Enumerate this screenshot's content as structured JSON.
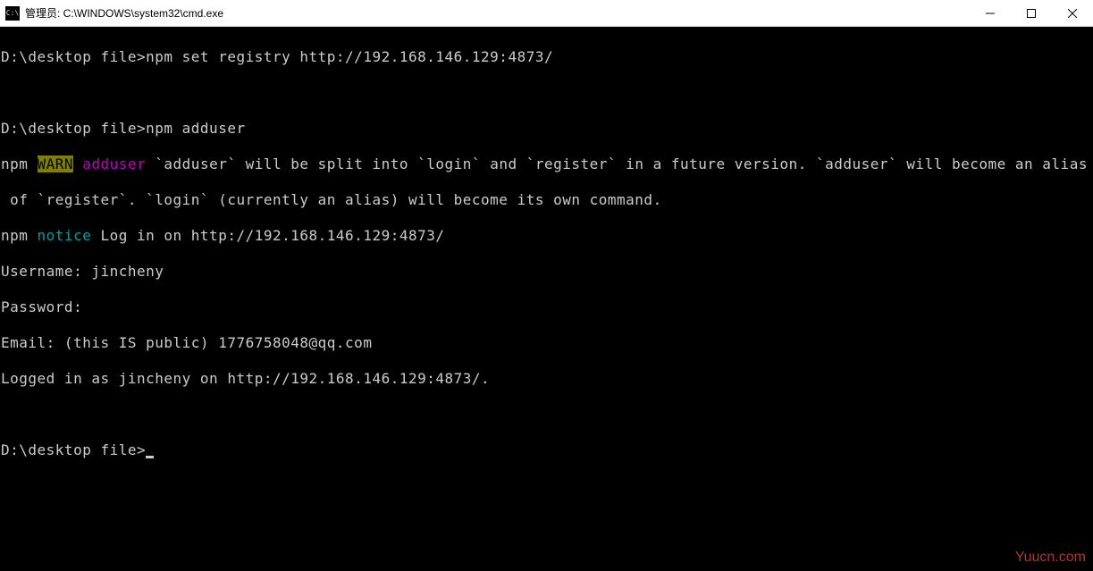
{
  "titlebar": {
    "icon_text": "C:\\",
    "title": "管理员: C:\\WINDOWS\\system32\\cmd.exe"
  },
  "terminal": {
    "line1_prompt": "D:\\desktop file>",
    "line1_cmd": "npm set registry http://192.168.146.129:4873/",
    "line2_prompt": "D:\\desktop file>",
    "line2_cmd": "npm adduser",
    "warn_prefix": "npm ",
    "warn_tag": "WARN",
    "warn_sp": " ",
    "warn_mod": "adduser",
    "warn_rest1": " `adduser` will be split into `login` and `register` in a future version. `adduser` will become an alias",
    "warn_rest2": " of `register`. `login` (currently an alias) will become its own command.",
    "notice_prefix": "npm ",
    "notice_tag": "notice",
    "notice_rest": " Log in on http://192.168.146.129:4873/",
    "username": "Username: jincheny",
    "password": "Password:",
    "email": "Email: (this IS public) 1776758048@qq.com",
    "logged": "Logged in as jincheny on http://192.168.146.129:4873/.",
    "final_prompt": "D:\\desktop file>"
  },
  "watermark": "Yuucn.com"
}
